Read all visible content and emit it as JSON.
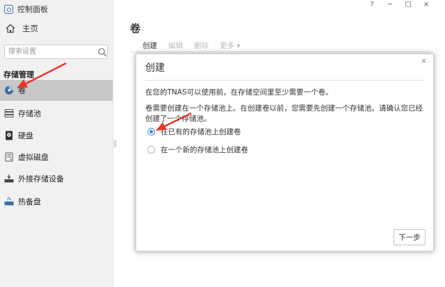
{
  "app": {
    "title": "控制面板"
  },
  "window_controls": {
    "help": "?",
    "minimize": "−",
    "maximize": "□",
    "close": "×"
  },
  "sidebar": {
    "home_label": "主页",
    "search_placeholder": "搜索设置",
    "section_title": "存储管理",
    "items": [
      {
        "label": "卷",
        "icon": "volume-icon",
        "active": true
      },
      {
        "label": "存储池",
        "icon": "storage-pool-icon"
      },
      {
        "label": "硬盘",
        "icon": "hard-disk-icon"
      },
      {
        "label": "虚拟磁盘",
        "icon": "virtual-disk-icon"
      },
      {
        "label": "外接存储设备",
        "icon": "external-storage-icon"
      },
      {
        "label": "热备盘",
        "icon": "hot-spare-icon"
      }
    ]
  },
  "main": {
    "title": "卷",
    "toolbar": {
      "create": "创建",
      "edit": "编辑",
      "delete": "删除",
      "more": "更多 ▾"
    }
  },
  "dialog": {
    "title": "创建",
    "close": "×",
    "paragraph1": "在您的TNAS可以使用前，在存储空间里至少需要一个卷。",
    "paragraph2": "卷需要创建在一个存储池上。在创建卷以前，您需要先创建一个存储池。请确认您已经创建了一个存储池。",
    "options": [
      {
        "label": "在已有的存储池上创建卷",
        "checked": true
      },
      {
        "label": "在一个新的存储池上创建卷",
        "checked": false
      }
    ],
    "next_button": "下一步"
  },
  "colors": {
    "accent": "#3d83d9",
    "annotation_arrow": "#e8372b",
    "sidebar_active": "#c8c8c8"
  }
}
